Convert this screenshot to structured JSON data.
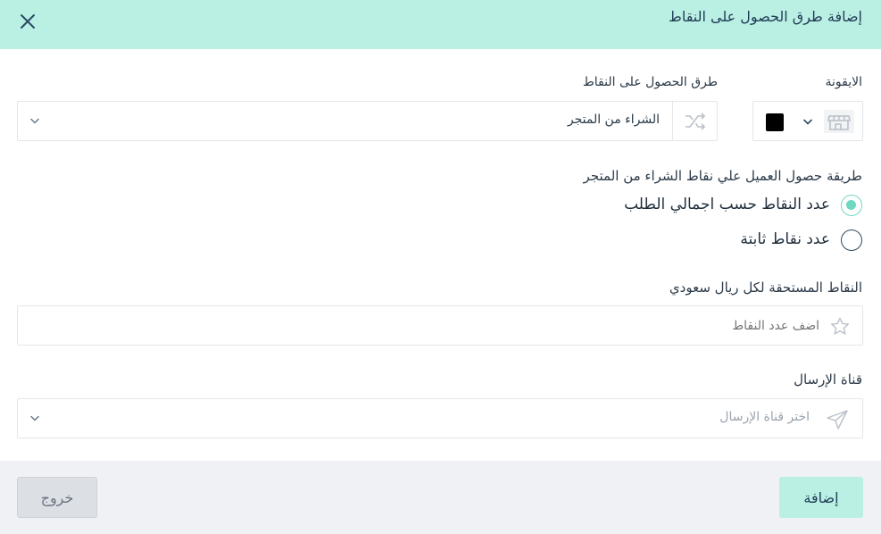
{
  "dialog": {
    "title": "إضافة طرق الحصول على النقاط"
  },
  "form": {
    "icon_label": "الايقونة",
    "icon_color": "#000000",
    "methods_label": "طرق الحصول على النقاط",
    "methods_value": "الشراء من المتجر",
    "purchase_label": "طريقة حصول العميل علي نقاط الشراء من المتجر",
    "options": [
      {
        "label": "عدد النقاط حسب اجمالي الطلب",
        "selected": true
      },
      {
        "label": "عدد نقاط ثابتة",
        "selected": false
      }
    ],
    "points_label": "النقاط المستحقة لكل ريال سعودي",
    "points_placeholder": "اضف عدد النقاط",
    "channel_label": "قناة الإرسال",
    "channel_placeholder": "اختر قناة الإرسال"
  },
  "footer": {
    "add_label": "إضافة",
    "exit_label": "خروج"
  },
  "colors": {
    "header_bg": "#baf0e3",
    "accent": "#6fd8c0",
    "footer_bg": "#eff1f4",
    "exit_bg": "#dcdfe3"
  }
}
